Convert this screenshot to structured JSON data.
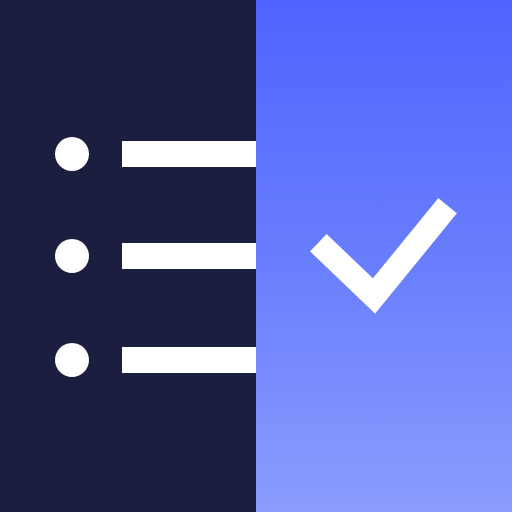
{
  "icon": {
    "name": "checklist-app-icon",
    "colors": {
      "left_panel": "#1c1e3f",
      "right_panel_top": "#4f64fe",
      "right_panel_bottom": "#8b9cfd",
      "foreground": "#ffffff"
    },
    "list_items": [
      {
        "icon": "bullet-point"
      },
      {
        "icon": "bullet-point"
      },
      {
        "icon": "bullet-point"
      }
    ],
    "status_icon": "checkmark-icon"
  }
}
